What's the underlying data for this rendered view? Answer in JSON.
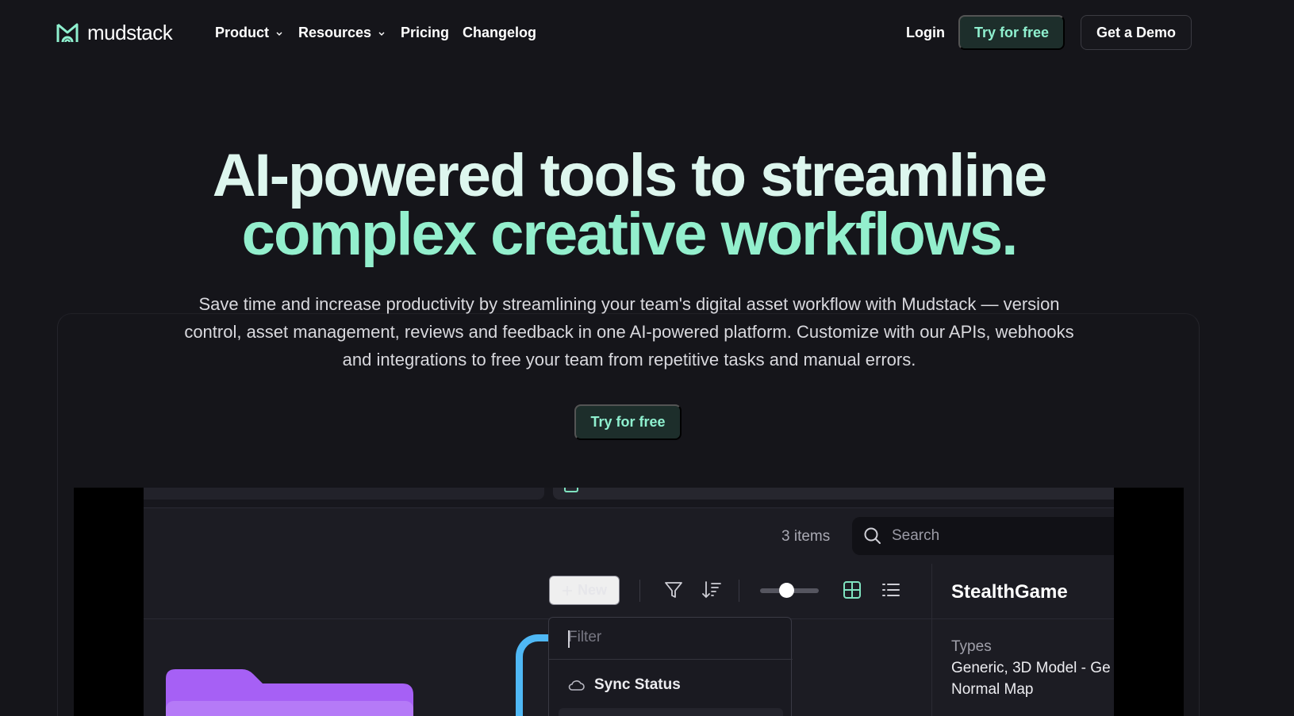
{
  "brand": {
    "name": "mudstack",
    "accent": "#93efcd"
  },
  "nav": {
    "items": [
      {
        "label": "Product",
        "has_dropdown": true
      },
      {
        "label": "Resources",
        "has_dropdown": true
      },
      {
        "label": "Pricing",
        "has_dropdown": false
      },
      {
        "label": "Changelog",
        "has_dropdown": false
      }
    ],
    "login": "Login",
    "try_free": "Try for free",
    "demo": "Get a Demo"
  },
  "hero": {
    "title_line1": "AI-powered tools to streamline",
    "title_line2": "complex creative workflows.",
    "subtitle": "Save time and increase productivity by streamlining your team's digital asset workflow with Mudstack — version control, asset management, reviews and feedback in one AI-powered platform. Customize with our APIs, webhooks and integrations to free your team from repetitive tasks and manual errors.",
    "cta": "Try for free"
  },
  "app_preview": {
    "items_count": "3 items",
    "search_placeholder": "Search",
    "new_button": "New",
    "toolbar_icons": [
      "filter-icon",
      "sort-icon",
      "size-slider",
      "grid-view-icon",
      "list-view-icon"
    ],
    "details": {
      "title": "StealthGame",
      "types_label": "Types",
      "types_value_line1": "Generic, 3D Model - Ge",
      "types_value_line2": "Normal Map"
    },
    "dropdown": {
      "filter_placeholder": "Filter",
      "items": [
        {
          "label": "Sync Status",
          "icon": "cloud-icon"
        }
      ]
    }
  }
}
